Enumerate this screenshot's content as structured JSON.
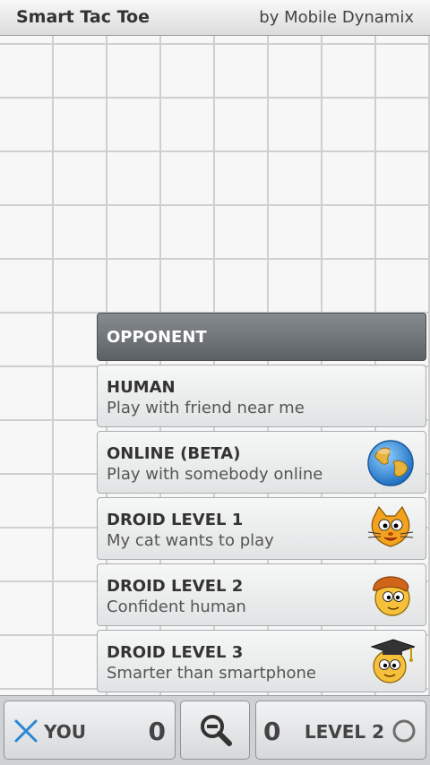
{
  "header": {
    "title": "Smart Tac Toe",
    "author": "by Mobile Dynamix"
  },
  "opponent_panel": {
    "heading": "OPPONENT",
    "options": [
      {
        "title": "HUMAN",
        "subtitle": "Play with friend near me",
        "icon": ""
      },
      {
        "title": "ONLINE (BETA)",
        "subtitle": "Play with somebody online",
        "icon": "globe-icon"
      },
      {
        "title": "DROID LEVEL 1",
        "subtitle": "My cat wants to play",
        "icon": "cat-face-icon"
      },
      {
        "title": "DROID LEVEL 2",
        "subtitle": "Confident human",
        "icon": "human-face-icon"
      },
      {
        "title": "DROID LEVEL 3",
        "subtitle": "Smarter than smartphone",
        "icon": "graduate-face-icon"
      }
    ]
  },
  "scorebar": {
    "player_mark": "x-icon",
    "player_label": "YOU",
    "player_score": "0",
    "zoom_icon": "zoom-out-icon",
    "opponent_score": "0",
    "level_label": "LEVEL 2",
    "opponent_mark": "o-icon"
  },
  "colors": {
    "x_mark": "#2a86d6",
    "o_mark": "#6e6e6e",
    "panel_header": "#5c6166"
  }
}
